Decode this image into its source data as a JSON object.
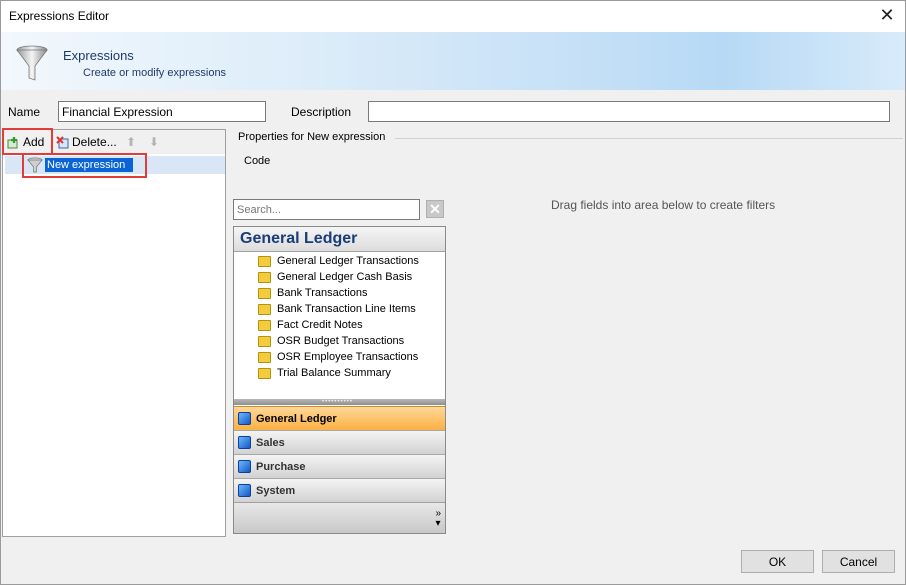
{
  "window": {
    "title": "Expressions Editor"
  },
  "banner": {
    "title": "Expressions",
    "subtitle": "Create or modify expressions"
  },
  "fields": {
    "name_label": "Name",
    "name_value": "Financial Expression",
    "description_label": "Description",
    "description_value": ""
  },
  "toolbar": {
    "add_label": "Add",
    "delete_label": "Delete..."
  },
  "tree": {
    "items": [
      {
        "label": "New expression",
        "editing": true
      }
    ]
  },
  "properties": {
    "title": "Properties for New expression",
    "code_label": "Code",
    "drag_hint": "Drag fields into area below to create filters"
  },
  "search": {
    "placeholder": "Search..."
  },
  "navigator": {
    "header": "General Ledger",
    "items": [
      "General Ledger Transactions",
      "General Ledger Cash Basis",
      "Bank Transactions",
      "Bank Transaction Line Items",
      "Fact Credit Notes",
      "OSR Budget Transactions",
      "OSR Employee Transactions",
      "Trial Balance Summary"
    ],
    "sections": [
      {
        "label": "General Ledger",
        "active": true
      },
      {
        "label": "Sales",
        "active": false
      },
      {
        "label": "Purchase",
        "active": false
      },
      {
        "label": "System",
        "active": false
      }
    ]
  },
  "buttons": {
    "ok": "OK",
    "cancel": "Cancel"
  },
  "colors": {
    "highlight": "#e23b3b",
    "active_section": "#fbb042",
    "selection": "#0a64d6"
  }
}
